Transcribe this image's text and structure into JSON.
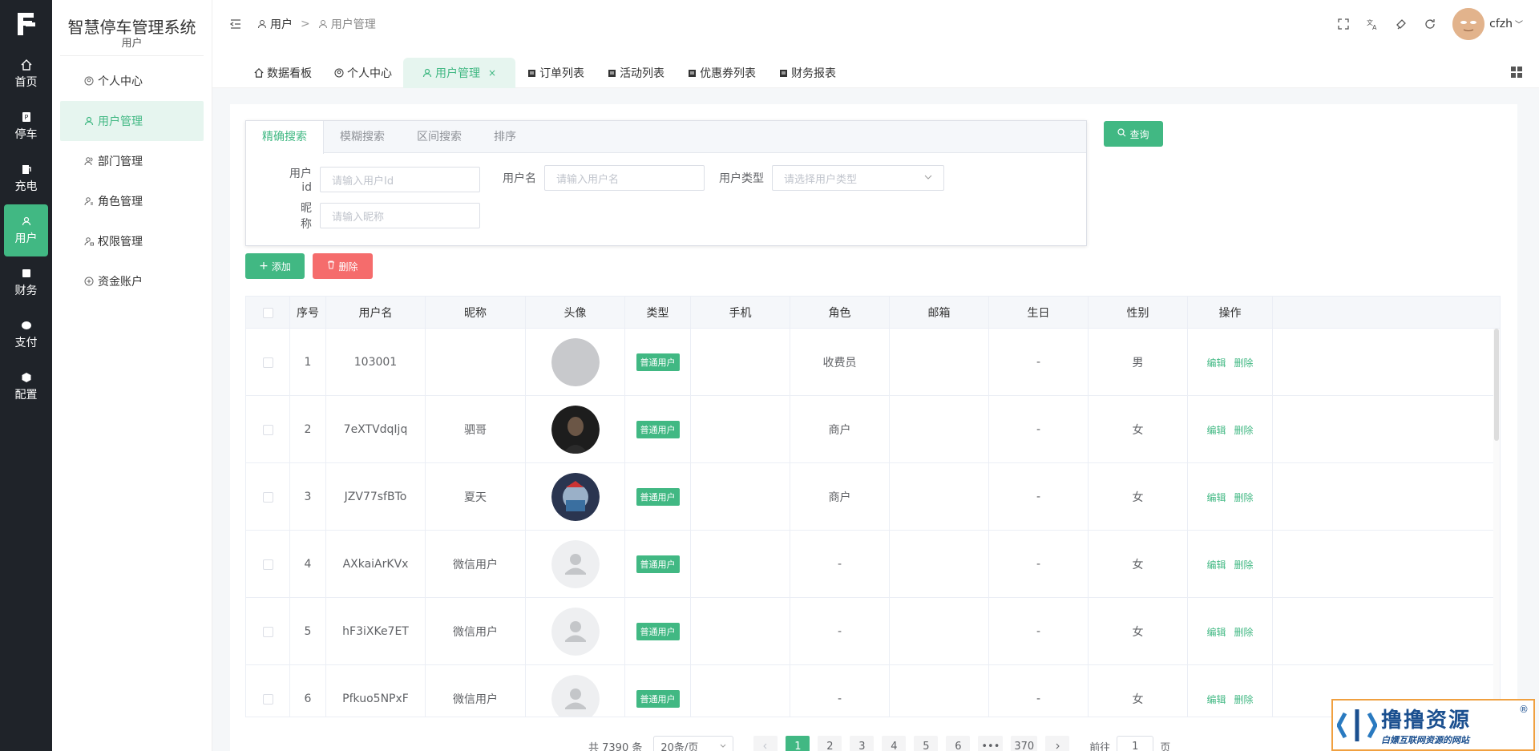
{
  "app": {
    "logo_text": "F",
    "system_title": "智慧停车管理系统",
    "system_subtitle": "用户"
  },
  "rail": [
    {
      "label": "首页",
      "icon": "home-icon"
    },
    {
      "label": "停车",
      "icon": "parking-icon"
    },
    {
      "label": "充电",
      "icon": "charging-icon"
    },
    {
      "label": "用户",
      "icon": "user-icon",
      "active": true
    },
    {
      "label": "财务",
      "icon": "finance-icon"
    },
    {
      "label": "支付",
      "icon": "payment-icon"
    },
    {
      "label": "配置",
      "icon": "config-icon"
    }
  ],
  "sidebar": {
    "items": [
      {
        "label": "个人中心",
        "icon": "location-icon"
      },
      {
        "label": "用户管理",
        "icon": "user-icon",
        "active": true
      },
      {
        "label": "部门管理",
        "icon": "user-group-icon"
      },
      {
        "label": "角色管理",
        "icon": "user-role-icon"
      },
      {
        "label": "权限管理",
        "icon": "user-lock-icon"
      },
      {
        "label": "资金账户",
        "icon": "wallet-icon"
      }
    ]
  },
  "header": {
    "breadcrumb": [
      "用户",
      "用户管理"
    ],
    "breadcrumb_sep": ">",
    "username": "cfzh"
  },
  "tabs": [
    {
      "label": "数据看板",
      "icon": "home-icon"
    },
    {
      "label": "个人中心",
      "icon": "location-icon"
    },
    {
      "label": "用户管理",
      "icon": "user-icon",
      "active": true,
      "close": "×"
    },
    {
      "label": "订单列表",
      "icon": "doc-icon"
    },
    {
      "label": "活动列表",
      "icon": "doc-icon"
    },
    {
      "label": "优惠券列表",
      "icon": "doc-icon"
    },
    {
      "label": "财务报表",
      "icon": "doc-icon"
    }
  ],
  "search": {
    "tabs": [
      "精确搜索",
      "模糊搜索",
      "区间搜索",
      "排序"
    ],
    "fields": {
      "user_id": {
        "label": "用户id",
        "placeholder": "请输入用户Id"
      },
      "username": {
        "label": "用户名",
        "placeholder": "请输入用户名"
      },
      "user_type": {
        "label": "用户类型",
        "placeholder": "请选择用户类型"
      },
      "nickname": {
        "label": "昵称",
        "placeholder": "请输入昵称"
      }
    },
    "query_label": "查询"
  },
  "actions": {
    "add_label": "添加",
    "delete_label": "删除"
  },
  "table": {
    "columns": [
      "序号",
      "用户名",
      "昵称",
      "头像",
      "类型",
      "手机",
      "角色",
      "邮箱",
      "生日",
      "性别",
      "操作"
    ],
    "edit_label": "编辑",
    "delete_label": "删除",
    "rows": [
      {
        "index": "1",
        "username": "103001",
        "nickname": "",
        "avatar": "gray-circle",
        "type": "普通用户",
        "phone": "",
        "role": "收费员",
        "email": "",
        "birthday": "-",
        "gender": "男"
      },
      {
        "index": "2",
        "username": "7eXTVdqIjq",
        "nickname": "驷哥",
        "avatar": "photo-dark",
        "type": "普通用户",
        "phone": "",
        "role": "商户",
        "email": "",
        "birthday": "-",
        "gender": "女"
      },
      {
        "index": "3",
        "username": "JZV77sfBTo",
        "nickname": "夏天",
        "avatar": "photo-blue",
        "type": "普通用户",
        "phone": "",
        "role": "商户",
        "email": "",
        "birthday": "-",
        "gender": "女"
      },
      {
        "index": "4",
        "username": "AXkaiArKVx",
        "nickname": "微信用户",
        "avatar": "placeholder",
        "type": "普通用户",
        "phone": "",
        "role": "-",
        "email": "",
        "birthday": "-",
        "gender": "女"
      },
      {
        "index": "5",
        "username": "hF3iXKe7ET",
        "nickname": "微信用户",
        "avatar": "placeholder",
        "type": "普通用户",
        "phone": "",
        "role": "-",
        "email": "",
        "birthday": "-",
        "gender": "女"
      },
      {
        "index": "6",
        "username": "Pfkuo5NPxF",
        "nickname": "微信用户",
        "avatar": "placeholder",
        "type": "普通用户",
        "phone": "",
        "role": "-",
        "email": "",
        "birthday": "-",
        "gender": "女"
      }
    ]
  },
  "pagination": {
    "total": "共 7390 条",
    "page_size": "20条/页",
    "pages": [
      "1",
      "2",
      "3",
      "4",
      "5",
      "6",
      "•••",
      "370"
    ],
    "current": "1",
    "goto_label": "前往",
    "goto_value": "1",
    "page_suffix": "页"
  },
  "watermark": {
    "title": "撸撸资源",
    "subtitle": "白嫖互联网资源的网站",
    "reg": "®"
  },
  "colors": {
    "accent": "#41b883",
    "danger": "#f56c6c",
    "rail_bg": "#1f2329"
  }
}
